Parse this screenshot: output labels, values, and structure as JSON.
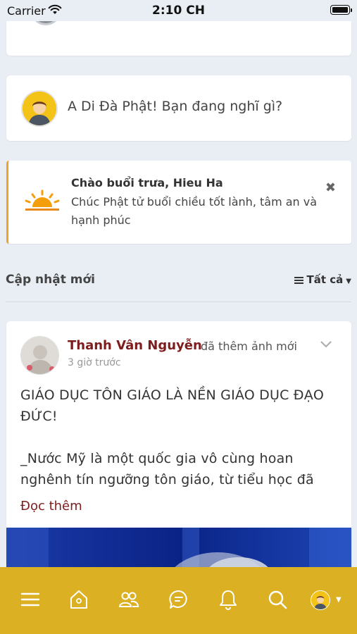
{
  "status_bar": {
    "carrier": "Carrier",
    "time": "2:10 CH"
  },
  "compose": {
    "placeholder": "A Di Đà Phật! Bạn đang nghĩ gì?"
  },
  "greeting": {
    "title": "Chào buổi trưa, Hieu Ha",
    "message": "Chúc Phật tử buổi chiều tốt lành, tâm an và hạnh phúc",
    "close_icon": "✖"
  },
  "feed": {
    "section_title": "Cập nhật mới",
    "filter_label": "Tất cả",
    "filter_caret": "▼"
  },
  "post": {
    "author": "Thanh Vân Nguyễn",
    "action": "đã thêm ảnh mới",
    "time": "3 giờ trước",
    "body": "GIÁO DỤC TÔN GIÁO LÀ NỀN GIÁO DỤC ĐẠO ĐỨC!\n\n_Nước Mỹ là một quốc gia vô cùng hoan nghênh tín ngưỡng tôn giáo, từ tiểu học đã",
    "read_more": "Đọc thêm"
  },
  "tabbar": {
    "items": [
      "menu-icon",
      "home-icon",
      "friends-icon",
      "messages-icon",
      "notifications-icon",
      "search-icon",
      "profile-avatar"
    ],
    "caret": "▼"
  },
  "colors": {
    "accent": "#7e1d1d",
    "tabbar": "#dbb022",
    "greeting_border": "#f0a22c",
    "background": "#e9eef4"
  }
}
